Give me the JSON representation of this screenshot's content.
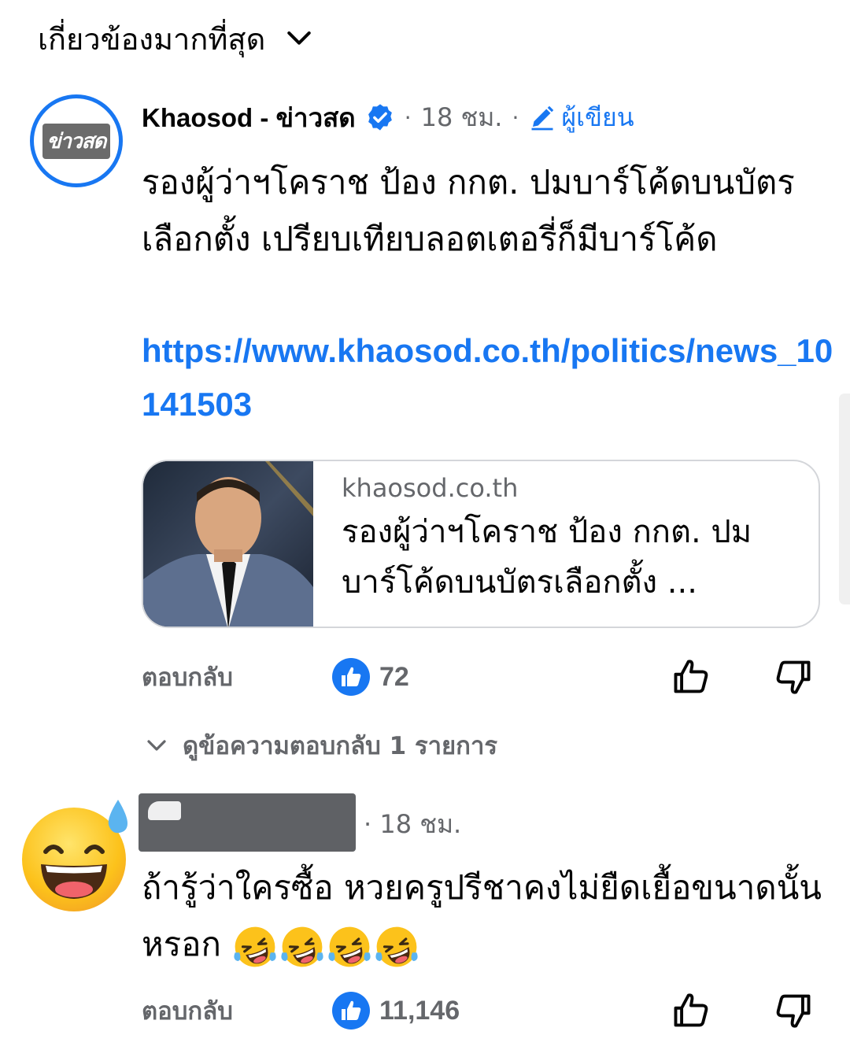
{
  "sort": {
    "label": "เกี่ยวข้องมากที่สุด"
  },
  "post": {
    "author": "Khaosod - ข่าวสด",
    "avatar_logo_text": "ข่าวสด",
    "time": "18 ชม.",
    "separator": "·",
    "author_tag": "ผู้เขียน",
    "text": "รองผู้ว่าฯโคราช ป้อง กกต. ปมบาร์โค้ดบนบัตรเลือกตั้ง เปรียบเทียบลอตเตอรี่ก็มีบาร์โค้ด",
    "link": "https://www.khaosod.co.th/politics/news_10141503",
    "card": {
      "domain": "khaosod.co.th",
      "title": "รองผู้ว่าฯโคราช ป้อง กกต. ปมบาร์โค้ดบนบัตรเลือกตั้ง ..."
    },
    "reply_label": "ตอบกลับ",
    "like_count": "72",
    "view_replies": "ดูข้อความตอบกลับ 1 รายการ"
  },
  "comment": {
    "time": "· 18 ชม.",
    "text": "ถ้ารู้ว่าใครซื้อ หวยครูปรีชาคงไม่ยืดเยื้อขนาดนั้นหรอก",
    "emojis": [
      "rofl-emoji",
      "rofl-emoji",
      "rofl-emoji",
      "rofl-emoji"
    ],
    "reply_label": "ตอบกลับ",
    "like_count": "11,146"
  },
  "colors": {
    "accent": "#1877f2",
    "muted": "#65676b",
    "text": "#050505"
  }
}
